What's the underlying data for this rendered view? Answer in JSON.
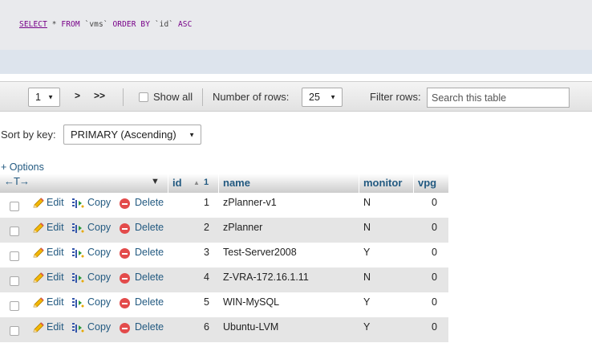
{
  "sql": {
    "select": "SELECT",
    "star": "*",
    "from": "FROM",
    "table": "`vms`",
    "order_by": "ORDER BY",
    "column": "`id`",
    "asc": "ASC"
  },
  "navbar": {
    "page_value": "1",
    "next_label": ">",
    "last_label": ">>",
    "show_all_label": "Show all",
    "rows_label": "Number of rows:",
    "rows_value": "25",
    "filter_label": "Filter rows:",
    "filter_placeholder": "Search this table"
  },
  "sort": {
    "label": "Sort by key:",
    "value": "PRIMARY (Ascending)"
  },
  "options_label": "+ Options",
  "table": {
    "arrows": "←T→",
    "sort_indicator": "▼",
    "headers": {
      "id": "id",
      "id_order": "1",
      "name": "name",
      "monitor": "monitor",
      "vpg": "vpg"
    },
    "actions": {
      "edit": "Edit",
      "copy": "Copy",
      "delete": "Delete"
    },
    "rows": [
      {
        "id": "1",
        "name": "zPlanner-v1",
        "monitor": "N",
        "vpg": "0"
      },
      {
        "id": "2",
        "name": "zPlanner",
        "monitor": "N",
        "vpg": "0"
      },
      {
        "id": "3",
        "name": "Test-Server2008",
        "monitor": "Y",
        "vpg": "0"
      },
      {
        "id": "4",
        "name": "Z-VRA-172.16.1.11",
        "monitor": "N",
        "vpg": "0"
      },
      {
        "id": "5",
        "name": "WIN-MySQL",
        "monitor": "Y",
        "vpg": "0"
      },
      {
        "id": "6",
        "name": "Ubuntu-LVM",
        "monitor": "Y",
        "vpg": "0"
      }
    ]
  },
  "colors": {
    "link": "#235a81",
    "delete_icon": "#e34b4b",
    "row_alt": "#e5e5e5",
    "sql_bg": "#e9eaed"
  },
  "icons": {
    "edit": "pencil-icon",
    "copy": "copy-icon",
    "delete": "delete-icon",
    "select_arrow": "chevron-down-icon"
  }
}
